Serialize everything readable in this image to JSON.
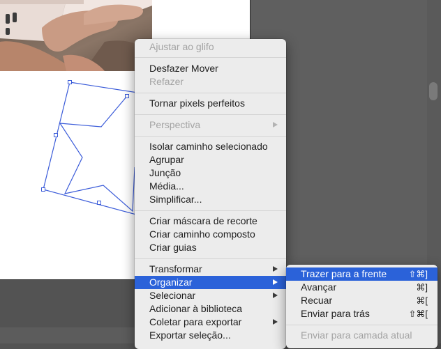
{
  "context_menu": {
    "items": [
      {
        "label": "Ajustar ao glifo",
        "disabled": true
      },
      {
        "label": "Desfazer Mover",
        "disabled": false
      },
      {
        "label": "Refazer",
        "disabled": true
      },
      {
        "label": "Tornar pixels perfeitos",
        "disabled": false
      },
      {
        "label": "Perspectiva",
        "disabled": true,
        "submenu": true
      },
      {
        "label": "Isolar caminho selecionado",
        "disabled": false
      },
      {
        "label": "Agrupar",
        "disabled": false
      },
      {
        "label": "Junção",
        "disabled": false
      },
      {
        "label": "Média...",
        "disabled": false
      },
      {
        "label": "Simplificar...",
        "disabled": false
      },
      {
        "label": "Criar máscara de recorte",
        "disabled": false
      },
      {
        "label": "Criar caminho composto",
        "disabled": false
      },
      {
        "label": "Criar guias",
        "disabled": false
      },
      {
        "label": "Transformar",
        "disabled": false,
        "submenu": true
      },
      {
        "label": "Organizar",
        "disabled": false,
        "submenu": true,
        "highlighted": true
      },
      {
        "label": "Selecionar",
        "disabled": false,
        "submenu": true
      },
      {
        "label": "Adicionar à biblioteca",
        "disabled": false
      },
      {
        "label": "Coletar para exportar",
        "disabled": false,
        "submenu": true
      },
      {
        "label": "Exportar seleção...",
        "disabled": false
      }
    ]
  },
  "arrange_submenu": {
    "items": [
      {
        "label": "Trazer para a frente",
        "shortcut": "⇧⌘]",
        "highlighted": true
      },
      {
        "label": "Avançar",
        "shortcut": "⌘]"
      },
      {
        "label": "Recuar",
        "shortcut": "⌘["
      },
      {
        "label": "Enviar para trás",
        "shortcut": "⇧⌘["
      },
      {
        "label": "Enviar para camada atual",
        "disabled": true
      }
    ]
  },
  "colors": {
    "selection": "#3a5bd9",
    "menu_highlight": "#2b62d9",
    "pasteboard": "#535353"
  }
}
